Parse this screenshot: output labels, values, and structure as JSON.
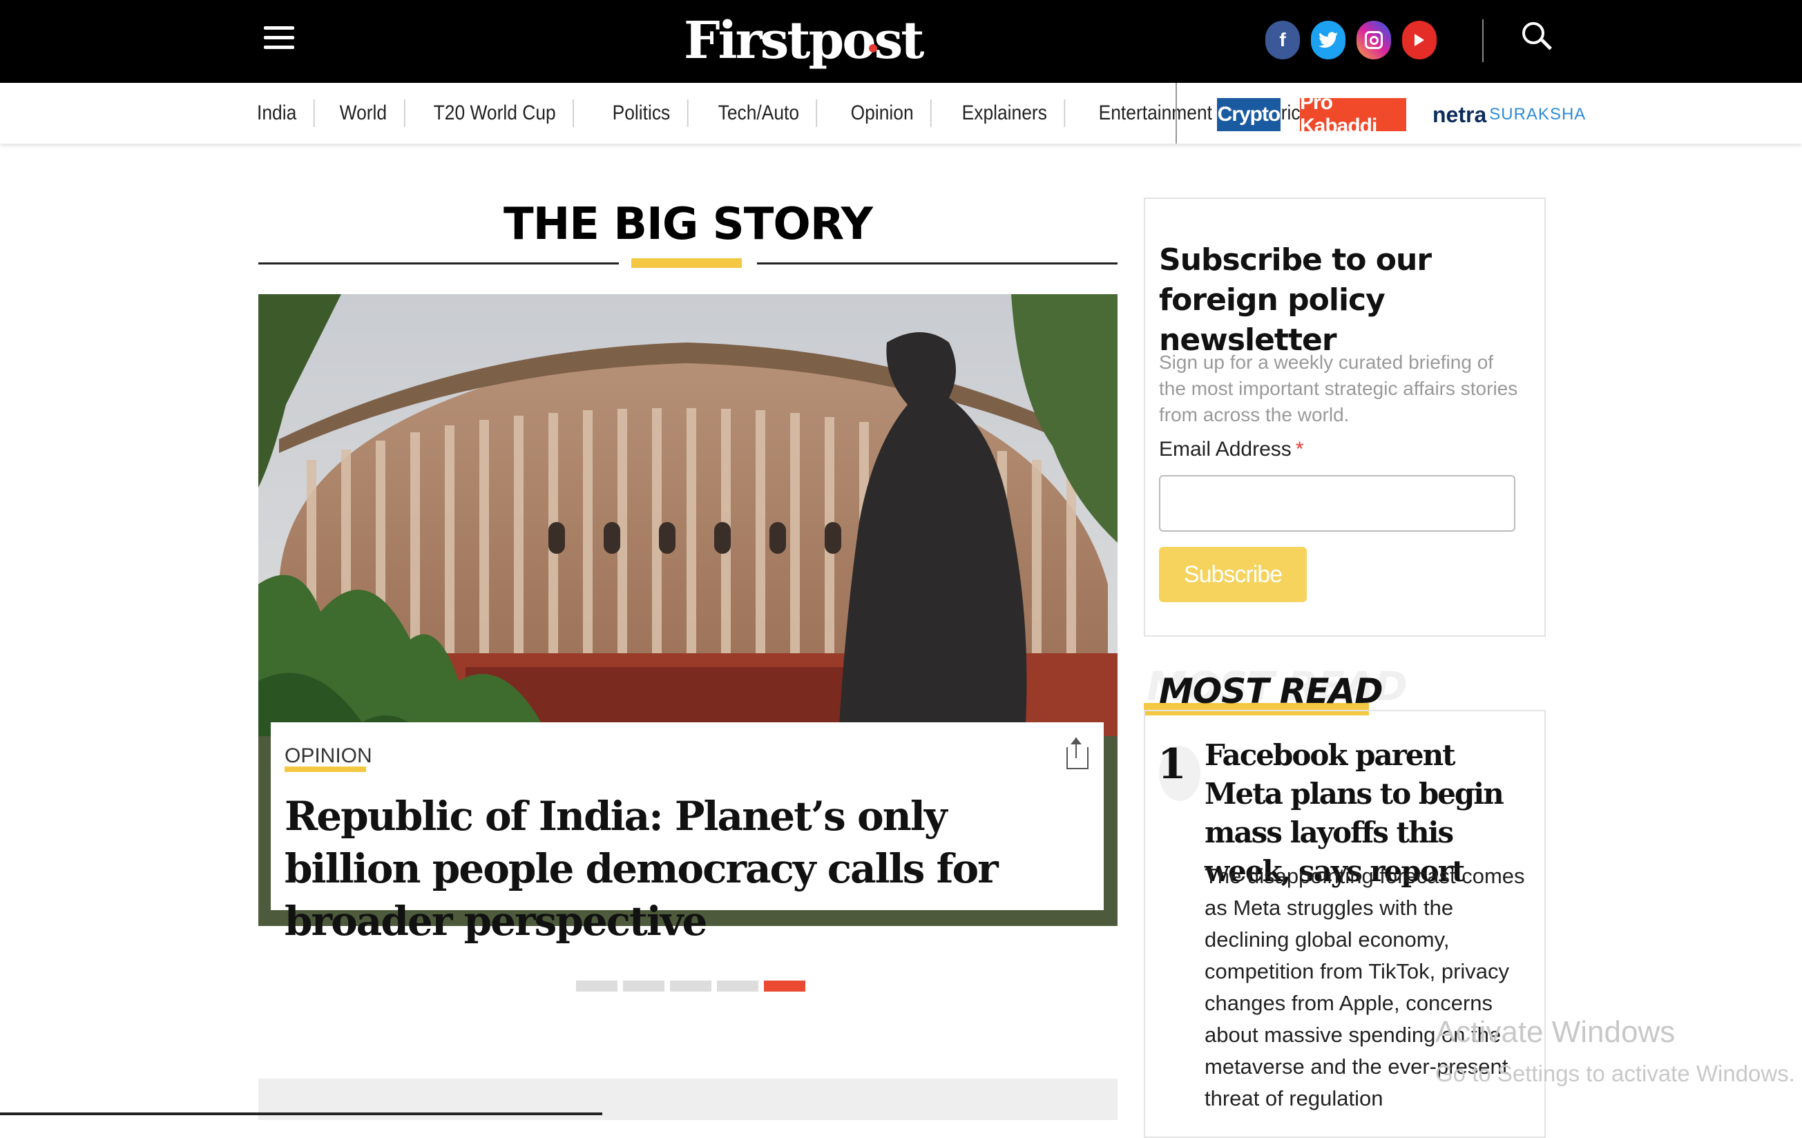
{
  "header": {
    "logo": "Firstpost",
    "social": [
      "facebook-icon",
      "twitter-icon",
      "instagram-icon",
      "youtube-icon"
    ],
    "colors": {
      "bar": "#000000",
      "accent": "#f4c842",
      "brand_dot": "#e53935"
    }
  },
  "nav": {
    "items": [
      "India",
      "World",
      "T20 World Cup",
      "Politics",
      "Tech/Auto",
      "Opinion",
      "Explainers",
      "Entertainment",
      "Cricket"
    ],
    "badges": {
      "crypto": "Crypto",
      "kabaddi": "Pro Kabaddi"
    },
    "netra": {
      "part1": "netra",
      "part2": "SURAKSHA"
    }
  },
  "big_story": {
    "section_title": "THE BIG STORY",
    "category": "OPINION",
    "headline": "Republic of India: Planet’s only billion people democracy calls for broader perspective",
    "slides": 5,
    "active_slide": 5
  },
  "newsletter": {
    "title": "Subscribe to our foreign policy newsletter",
    "description": "Sign up for a weekly curated briefing of the most important strategic affairs stories from across the world.",
    "email_label": "Email Address",
    "required_mark": "*",
    "email_value": "",
    "button": "Subscribe"
  },
  "most_read": {
    "title": "MOST READ",
    "items": [
      {
        "rank": "1",
        "headline": "Facebook parent Meta plans to begin mass layoffs this week, says report",
        "summary": "The disappointing forecast comes as Meta struggles with the declining global economy, competition from TikTok, privacy changes from Apple, concerns about massive spending on the metaverse and the ever-present threat of regulation"
      }
    ]
  },
  "watermark": {
    "line1": "Activate Windows",
    "line2": "Go to Settings to activate Windows."
  }
}
